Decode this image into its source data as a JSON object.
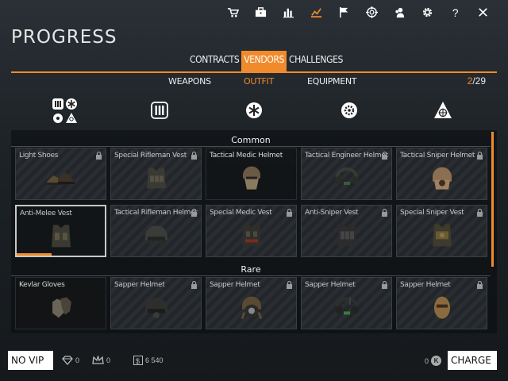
{
  "page": {
    "title": "PROGRESS"
  },
  "top_icons": [
    "cart-icon",
    "briefcase-icon",
    "stats-icon",
    "progress-icon",
    "flag-icon",
    "crosshair-icon",
    "friends-icon",
    "gear-icon",
    "help-icon",
    "close-icon"
  ],
  "colors": {
    "accent": "#f18a2b",
    "text": "#e8e8e8"
  },
  "main_tabs": [
    {
      "label": "CONTRACTS",
      "active": false
    },
    {
      "label": "VENDORS",
      "active": true
    },
    {
      "label": "CHALLENGES",
      "active": false
    }
  ],
  "sub_tabs": [
    {
      "label": "WEAPONS",
      "active": false
    },
    {
      "label": "OUTFIT",
      "active": true
    },
    {
      "label": "EQUIPMENT",
      "active": false
    }
  ],
  "counter": {
    "current": "2",
    "total": "/29"
  },
  "categories": [
    "all-classes-icon",
    "rifleman-icon",
    "medic-icon",
    "engineer-icon",
    "sniper-icon"
  ],
  "sections": {
    "common": {
      "label": "Common",
      "items": [
        {
          "name": "Light Shoes",
          "locked": true
        },
        {
          "name": "Special Rifleman Vest",
          "locked": true
        },
        {
          "name": "Tactical Medic Helmet",
          "locked": false
        },
        {
          "name": "Tactical Engineer Helmet",
          "locked": true
        },
        {
          "name": "Tactical Sniper Helmet",
          "locked": true
        },
        {
          "name": "Anti-Melee Vest",
          "locked": false,
          "selected": true,
          "progress": 0.4
        },
        {
          "name": "Tactical Rifleman Helmet",
          "locked": true
        },
        {
          "name": "Special Medic Vest",
          "locked": true
        },
        {
          "name": "Anti-Sniper Vest",
          "locked": true
        },
        {
          "name": "Special Sniper Vest",
          "locked": true
        }
      ]
    },
    "rare": {
      "label": "Rare",
      "items": [
        {
          "name": "Kevlar Gloves",
          "locked": false
        },
        {
          "name": "Sapper Helmet",
          "locked": true
        },
        {
          "name": "Sapper Helmet",
          "locked": true
        },
        {
          "name": "Sapper Helmet",
          "locked": true
        },
        {
          "name": "Sapper Helmet",
          "locked": true
        }
      ]
    }
  },
  "bottom": {
    "vip_label": "NO VIP",
    "currency": [
      {
        "icon": "crystal-icon",
        "value": "0"
      },
      {
        "icon": "crown-icon",
        "value": "0"
      },
      {
        "icon": "dollar-icon",
        "value": "6 540"
      }
    ],
    "kredits": "0",
    "kredits_symbol": "K",
    "charge_label": "CHARGE"
  }
}
